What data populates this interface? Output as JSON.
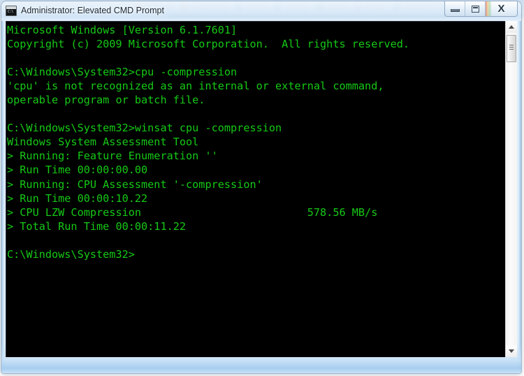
{
  "window": {
    "title": "Administrator: Elevated CMD Prompt",
    "icon": "cmd-console-icon",
    "icon_prompt_glyph": "C:\\",
    "controls": {
      "minimize_label": "–",
      "maximize_label": "□",
      "close_label": "X"
    }
  },
  "console": {
    "foreground_color": "#16c916",
    "background_color": "#000000",
    "lines": [
      "Microsoft Windows [Version 6.1.7601]",
      "Copyright (c) 2009 Microsoft Corporation.  All rights reserved.",
      "",
      "C:\\Windows\\System32>cpu -compression",
      "'cpu' is not recognized as an internal or external command,",
      "operable program or batch file.",
      "",
      "C:\\Windows\\System32>winsat cpu -compression",
      "Windows System Assessment Tool",
      "> Running: Feature Enumeration ''",
      "> Run Time 00:00:00.00",
      "> Running: CPU Assessment '-compression'",
      "> Run Time 00:00:10.22",
      "> CPU LZW Compression                          578.56 MB/s",
      "> Total Run Time 00:00:11.22",
      "",
      "C:\\Windows\\System32>"
    ],
    "result": {
      "metric_label": "CPU LZW Compression",
      "value": "578.56",
      "unit": "MB/s"
    },
    "os_version": "6.1.7601",
    "command_1": "cpu -compression",
    "command_2": "winsat cpu -compression",
    "prompt": "C:\\Windows\\System32>",
    "scrollbar": {
      "up_arrow": "scroll-up-arrow-icon",
      "down_arrow": "scroll-down-arrow-icon",
      "thumb": "scrollbar-thumb"
    }
  }
}
